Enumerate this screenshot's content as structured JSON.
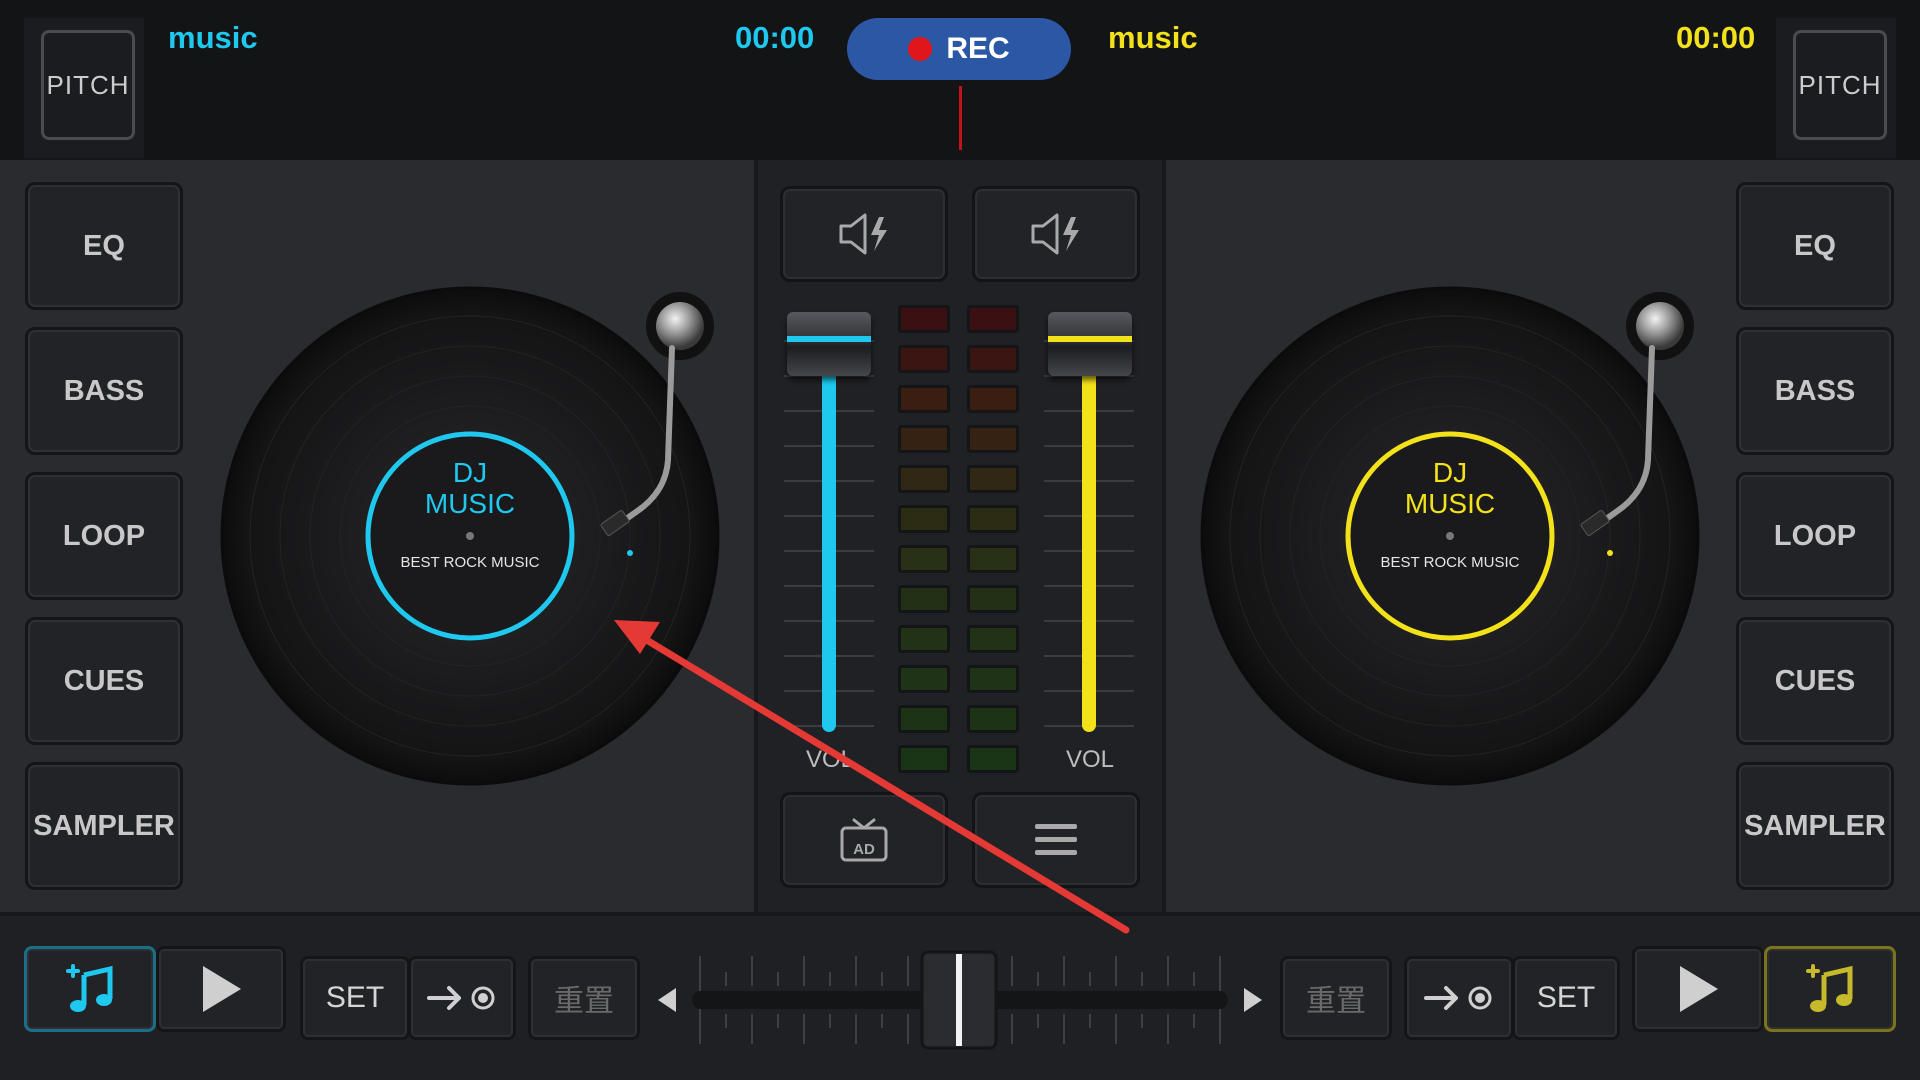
{
  "top": {
    "left_pitch": "PITCH",
    "right_pitch": "PITCH",
    "left_track": "music",
    "right_track": "music",
    "left_time": "00:00",
    "right_time": "00:00",
    "rec": "REC"
  },
  "left_deck": {
    "buttons": [
      "EQ",
      "BASS",
      "LOOP",
      "CUES",
      "SAMPLER"
    ],
    "disc_title_line1": "DJ",
    "disc_title_line2": "MUSIC",
    "disc_subtitle": "BEST ROCK MUSIC",
    "accent": "#1fc8ee"
  },
  "right_deck": {
    "buttons": [
      "EQ",
      "BASS",
      "LOOP",
      "CUES",
      "SAMPLER"
    ],
    "disc_title_line1": "DJ",
    "disc_title_line2": "MUSIC",
    "disc_subtitle": "BEST ROCK MUSIC",
    "accent": "#f3e21a"
  },
  "mixer": {
    "left_vol_label": "VOL",
    "right_vol_label": "VOL",
    "ad_label": "AD",
    "icons": [
      "speaker-bolt-icon",
      "speaker-bolt-icon",
      "ad-tv-icon",
      "menu-icon"
    ]
  },
  "bottom": {
    "left_set": "SET",
    "right_set": "SET",
    "left_reset": "重置",
    "right_reset": "重置"
  },
  "annotation": {
    "color": "#e53935"
  }
}
